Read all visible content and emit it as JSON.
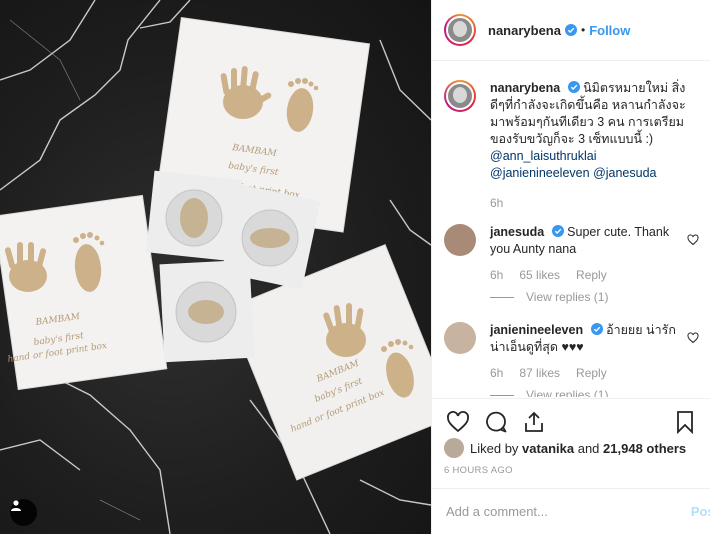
{
  "post": {
    "username": "nanarybena",
    "follow_label": "Follow",
    "dot": "•"
  },
  "caption": {
    "username": "nanarybena",
    "text": "นิมิตรหมายใหม่ สิ่งดีๆที่กำลังจะเกิดขึ้นคือ หลานกำลังจะมาพร้อมๆกันทีเดียว 3 คน การเตรียมของรับขวัญก็จะ 3 เซ็ทแบบนี้ :) ",
    "mentions": [
      "@ann_laisuthruklai",
      "@janienineeleven",
      "@janesuda"
    ],
    "time": "6h"
  },
  "comments": [
    {
      "username": "janesuda",
      "text": "Super cute. Thank you Aunty nana",
      "time": "6h",
      "likes": "65 likes",
      "reply_label": "Reply",
      "view_replies": "View replies (1)"
    },
    {
      "username": "janienineeleven",
      "text": "อ้ายยย น่ารักน่าเอ็นดูที่สุด ♥♥♥",
      "time": "6h",
      "likes": "87 likes",
      "reply_label": "Reply",
      "view_replies": "View replies (1)"
    }
  ],
  "likes_line": {
    "prefix": "Liked by ",
    "user": "vatanika",
    "middle": " and ",
    "count": "21,948 others"
  },
  "timestamp": "6 HOURS AGO",
  "add_comment": {
    "placeholder": "Add a comment...",
    "post_label": "Post"
  },
  "photo_print": {
    "brand": "BAMBAM",
    "line1": "baby's first",
    "line2": "hand or foot print box"
  },
  "colors": {
    "accent": "#3897f0",
    "verified": "#3897f0",
    "mention": "#003569",
    "muted": "#999999",
    "gold_print": "#c8a878"
  },
  "icons": [
    "heart-icon",
    "comment-icon",
    "share-icon",
    "bookmark-icon",
    "verified-badge-icon",
    "user-tag-icon"
  ]
}
